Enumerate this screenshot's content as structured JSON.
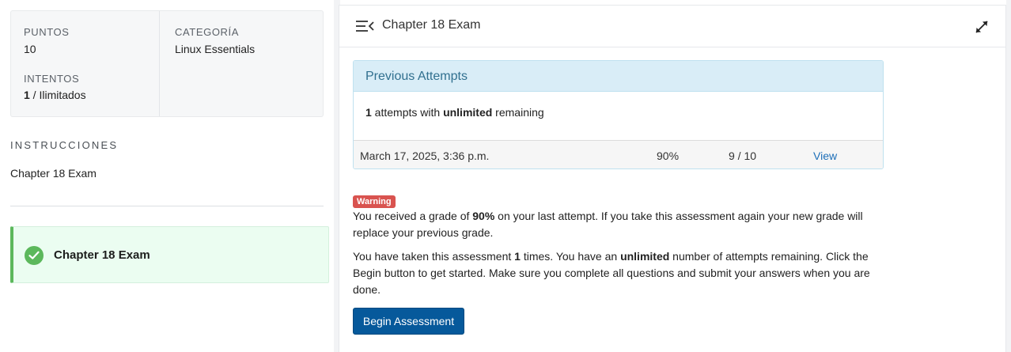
{
  "stats": {
    "points_label": "PUNTOS",
    "points_value": "10",
    "category_label": "CATEGORÍA",
    "category_value": "Linux Essentials",
    "attempts_label": "INTENTOS",
    "attempts_used": "1",
    "attempts_rest": " / Ilimitados"
  },
  "instructions": {
    "label": "INSTRUCCIONES",
    "text": "Chapter 18 Exam"
  },
  "exam_item": {
    "title": "Chapter 18 Exam",
    "status_icon": "check-circle-icon",
    "status_color": "#5cb85c"
  },
  "panel": {
    "title": "Chapter 18 Exam",
    "menu_icon": "collapse-menu-icon",
    "expand_icon": "expand-icon"
  },
  "previous_attempts": {
    "title": "Previous Attempts",
    "summary_count": "1",
    "summary_mid": " attempts with ",
    "summary_unlimited": "unlimited",
    "summary_end": " remaining",
    "rows": [
      {
        "date": "March 17, 2025, 3:36 p.m.",
        "percent": "90%",
        "score": "9 / 10",
        "action": "View"
      }
    ]
  },
  "warning": {
    "badge": "Warning",
    "badge_color": "#d9534f",
    "p1_a": "You received a grade of ",
    "p1_grade": "90%",
    "p1_b": " on your last attempt. If you take this assessment again your new grade will replace your previous grade.",
    "p2_a": "You have taken this assessment ",
    "p2_count": "1",
    "p2_b": " times. You have an ",
    "p2_unlimited": "unlimited",
    "p2_c": " number of attempts remaining. Click the Begin button to get started. Make sure you complete all questions and submit your answers when you are done."
  },
  "begin_button": {
    "label": "Begin Assessment",
    "color": "#06599b"
  }
}
